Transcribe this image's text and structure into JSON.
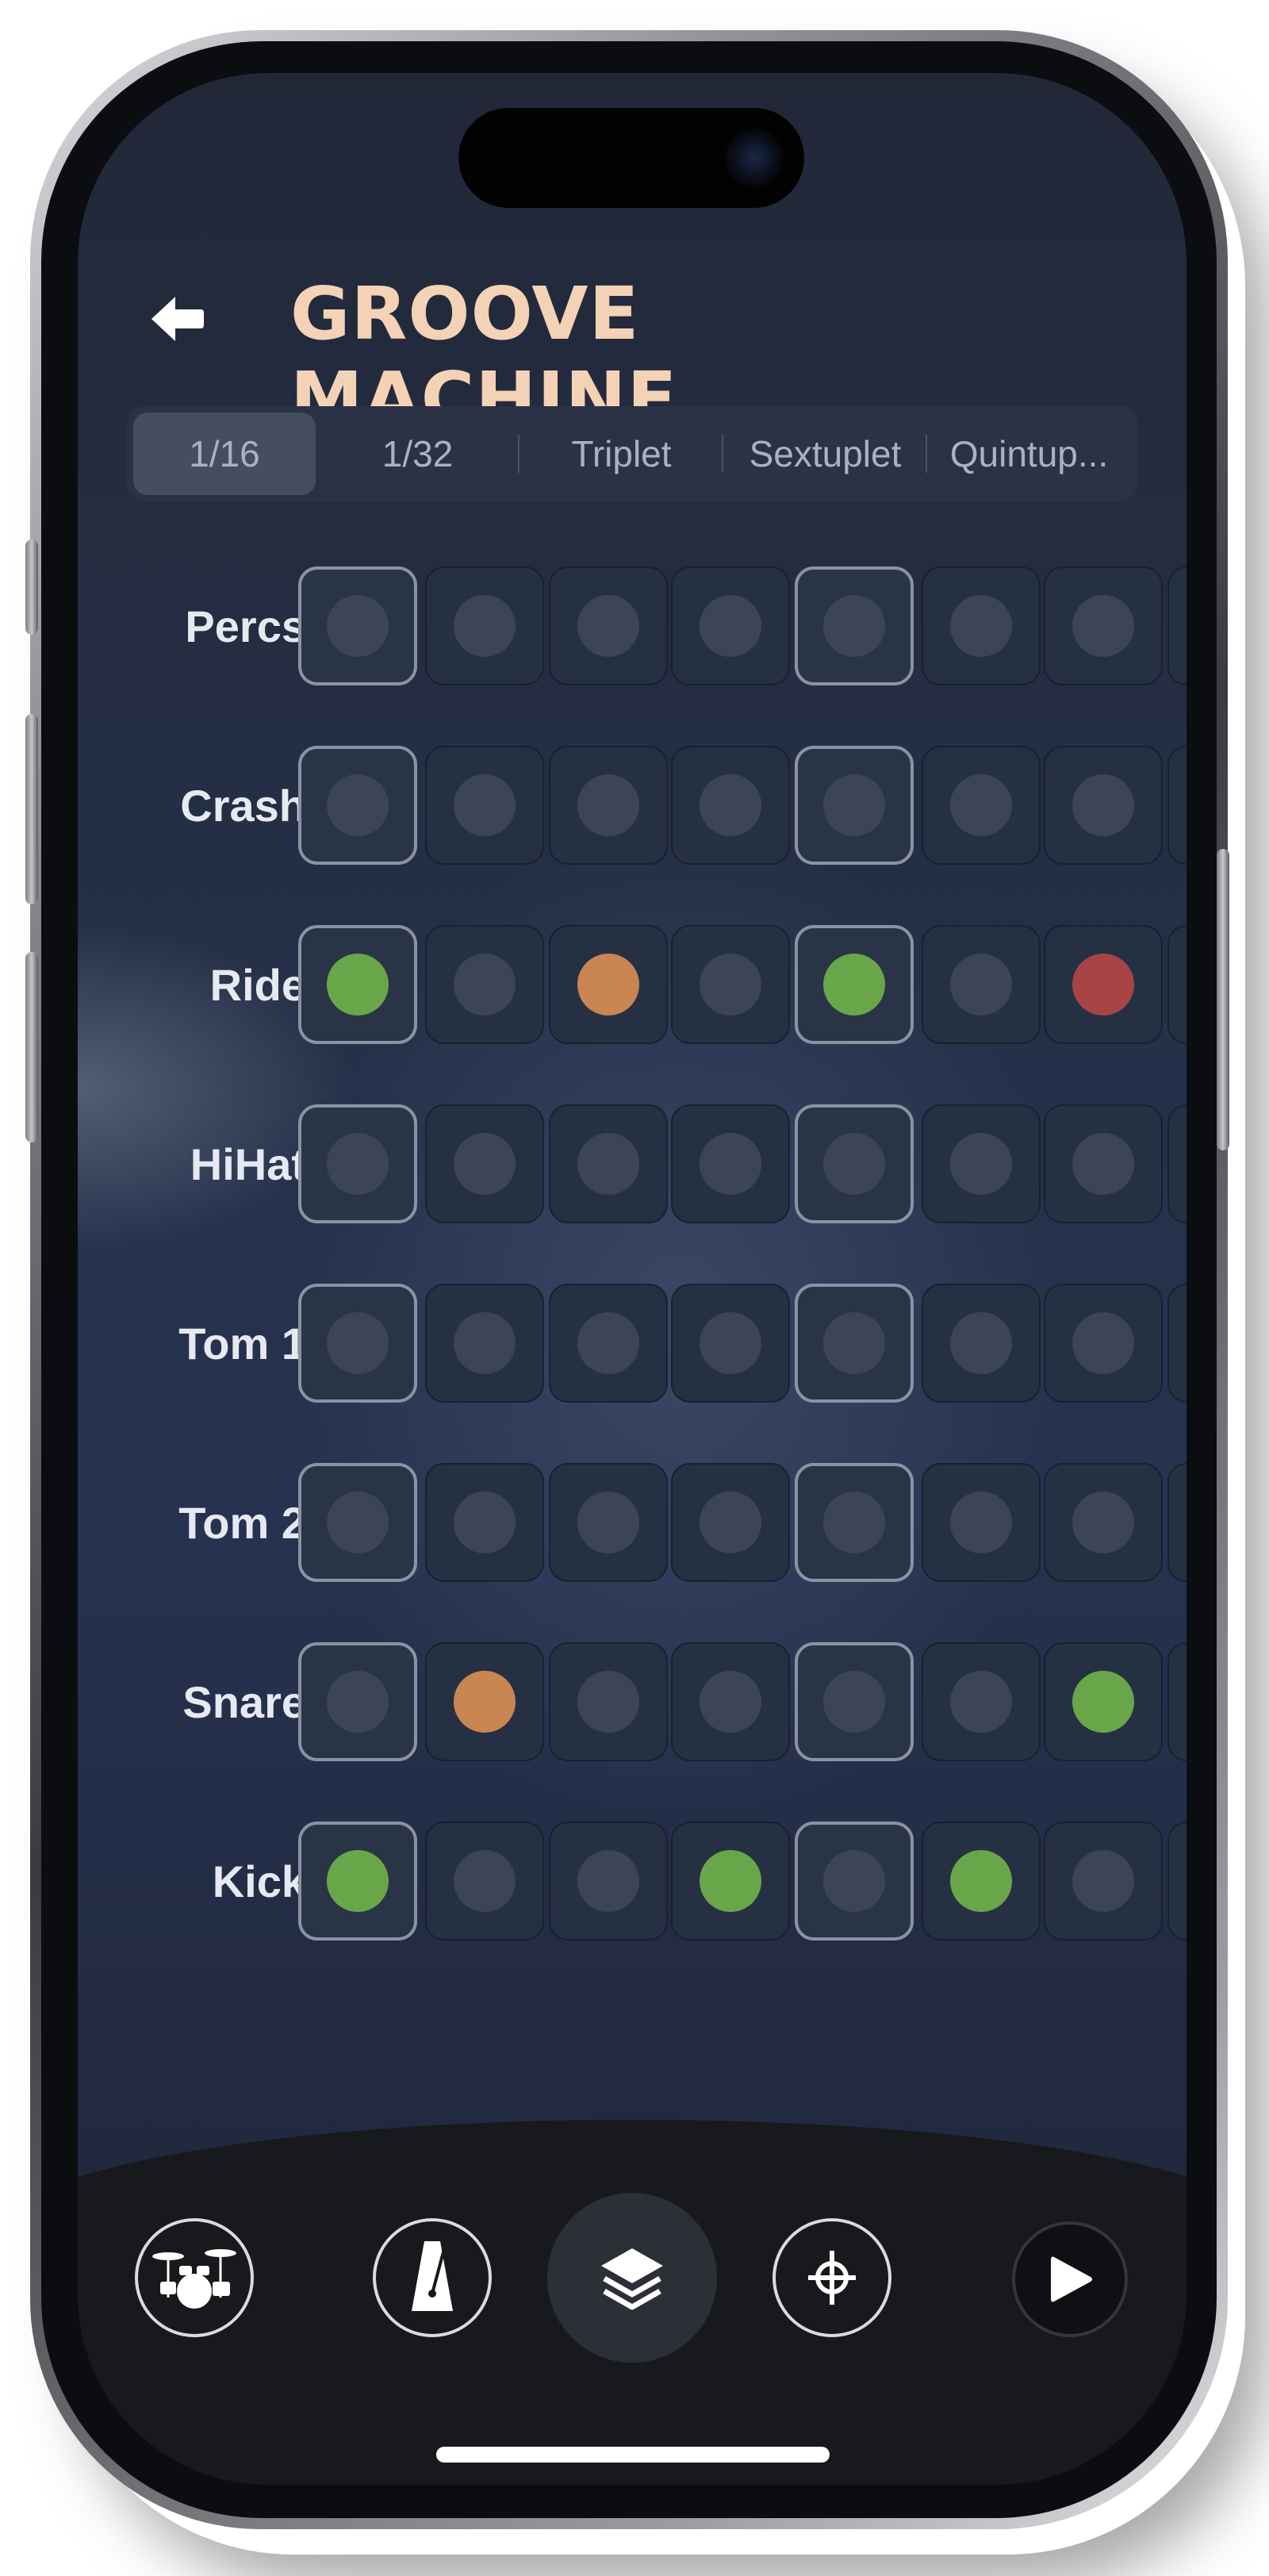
{
  "header": {
    "title": "GROOVE MACHINE",
    "back_icon": "back-arrow-icon",
    "title_color": "#f3d2b6"
  },
  "subdivisions": {
    "tabs": [
      "1/16",
      "1/32",
      "Triplet",
      "Sextuplet",
      "Quintup..."
    ],
    "selected": "1/16"
  },
  "sequencer": {
    "visible_steps": 7,
    "colors": {
      "green": "#69a64a",
      "orange": "#c98552",
      "red": "#a84446",
      "off": "#3b4556"
    },
    "rows": [
      {
        "label": "Percs",
        "steps": [
          "off",
          "off",
          "off",
          "off",
          "off",
          "off",
          "off"
        ]
      },
      {
        "label": "Crash",
        "steps": [
          "off",
          "off",
          "off",
          "off",
          "off",
          "off",
          "off"
        ]
      },
      {
        "label": "Ride",
        "steps": [
          "green",
          "off",
          "orange",
          "off",
          "green",
          "off",
          "red"
        ]
      },
      {
        "label": "HiHat",
        "steps": [
          "off",
          "off",
          "off",
          "off",
          "off",
          "off",
          "off"
        ]
      },
      {
        "label": "Tom 1",
        "steps": [
          "off",
          "off",
          "off",
          "off",
          "off",
          "off",
          "off"
        ]
      },
      {
        "label": "Tom 2",
        "steps": [
          "off",
          "off",
          "off",
          "off",
          "off",
          "off",
          "off"
        ]
      },
      {
        "label": "Snare",
        "steps": [
          "off",
          "orange",
          "off",
          "off",
          "off",
          "off",
          "green"
        ]
      },
      {
        "label": "Kick",
        "steps": [
          "green",
          "off",
          "off",
          "green",
          "off",
          "green",
          "off"
        ]
      }
    ],
    "beat_steps": [
      0,
      4
    ]
  },
  "bottom_nav": {
    "items": [
      {
        "name": "drum-kit-icon",
        "state": "outline"
      },
      {
        "name": "metronome-icon",
        "state": "outline"
      },
      {
        "name": "layers-icon",
        "state": "active"
      },
      {
        "name": "crosshair-icon",
        "state": "outline"
      },
      {
        "name": "play-icon",
        "state": "play"
      }
    ]
  }
}
